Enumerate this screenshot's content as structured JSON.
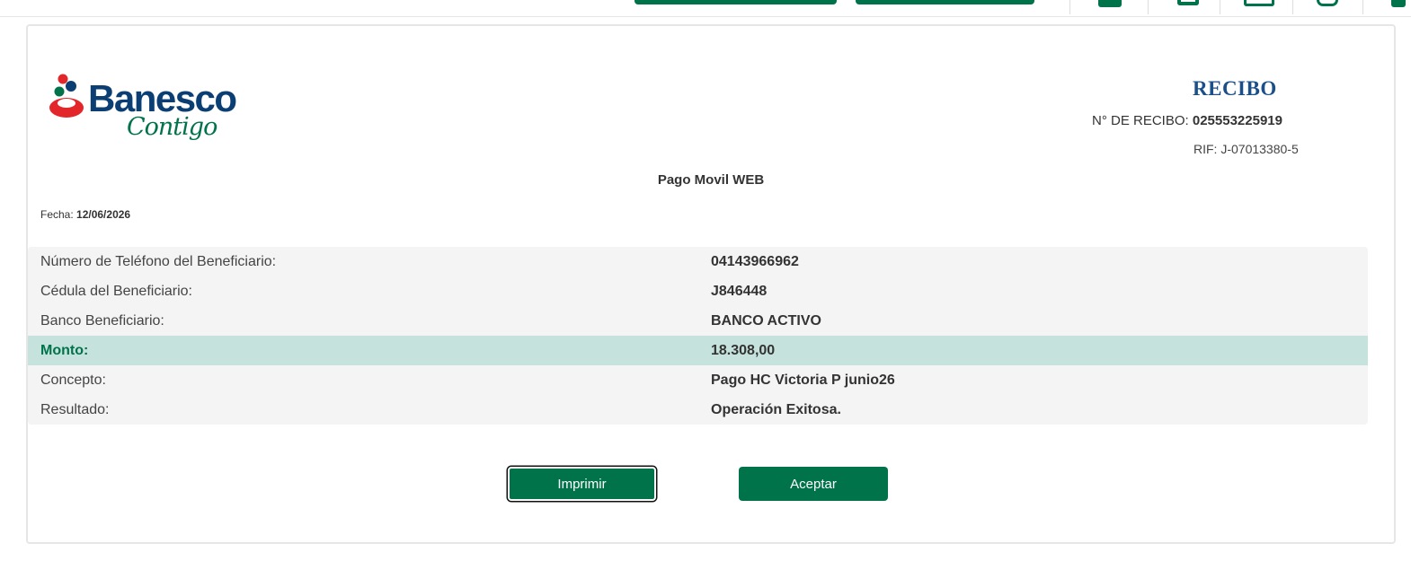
{
  "brand": {
    "name": "Banesco",
    "tagline": "Contigo",
    "colors": {
      "primary": "#00734a",
      "brand_blue": "#0b3f73",
      "logo_red": "#e3262a",
      "highlight": "#c5e3dc"
    }
  },
  "receipt": {
    "title": "RECIBO",
    "number_label": "N° DE RECIBO:",
    "number_value": "025553225919",
    "rif": "RIF: J-07013380-5",
    "service": "Pago Movil WEB",
    "date_label": "Fecha:",
    "date_value": "12/06/2026"
  },
  "details": [
    {
      "label": "Número de Teléfono del Beneficiario:",
      "value": "04143966962",
      "highlight": false
    },
    {
      "label": "Cédula del Beneficiario:",
      "value": "J846448",
      "highlight": false
    },
    {
      "label": "Banco Beneficiario:",
      "value": "BANCO ACTIVO",
      "highlight": false
    },
    {
      "label": "Monto:",
      "value": "18.308,00",
      "highlight": true
    },
    {
      "label": "Concepto:",
      "value": "Pago HC Victoria P junio26",
      "highlight": false
    },
    {
      "label": "Resultado:",
      "value": "Operación Exitosa.",
      "highlight": false
    }
  ],
  "actions": {
    "print_label": "Imprimir",
    "accept_label": "Aceptar"
  },
  "topbar": {
    "icons": [
      "lock-icon",
      "transfer-icon",
      "mail-icon",
      "help-icon",
      "exit-icon"
    ]
  }
}
